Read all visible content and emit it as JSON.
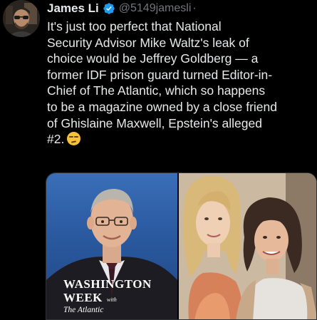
{
  "tweet": {
    "author_name": "James Li",
    "handle": "@5149jamesli",
    "separator": "·",
    "body_lines": [
      "It's just too perfect that National",
      "Security Advisor Mike Waltz's leak of",
      "choice would be Jeffrey Goldberg — a",
      "former IDF prison guard turned Editor-in-",
      "Chief of The Atlantic, which so happens",
      "to be a magazine owned by a close friend",
      "of Ghislaine Maxwell, Epstein's alleged",
      "#2."
    ],
    "emoji": "smirking-face",
    "verified_badge_color": "#1d9bf0"
  },
  "media": {
    "left_image": {
      "logo_line1": "WASHINGTON",
      "logo_line2": "WEEK",
      "logo_with": "with",
      "logo_line3": "The Atlantic",
      "background_color": "#2b5aa0"
    },
    "right_image": {
      "background_color": "#c8b8a4"
    }
  },
  "colors": {
    "background": "#000000",
    "text_primary": "#e7e9ea",
    "text_secondary": "#71767b"
  }
}
